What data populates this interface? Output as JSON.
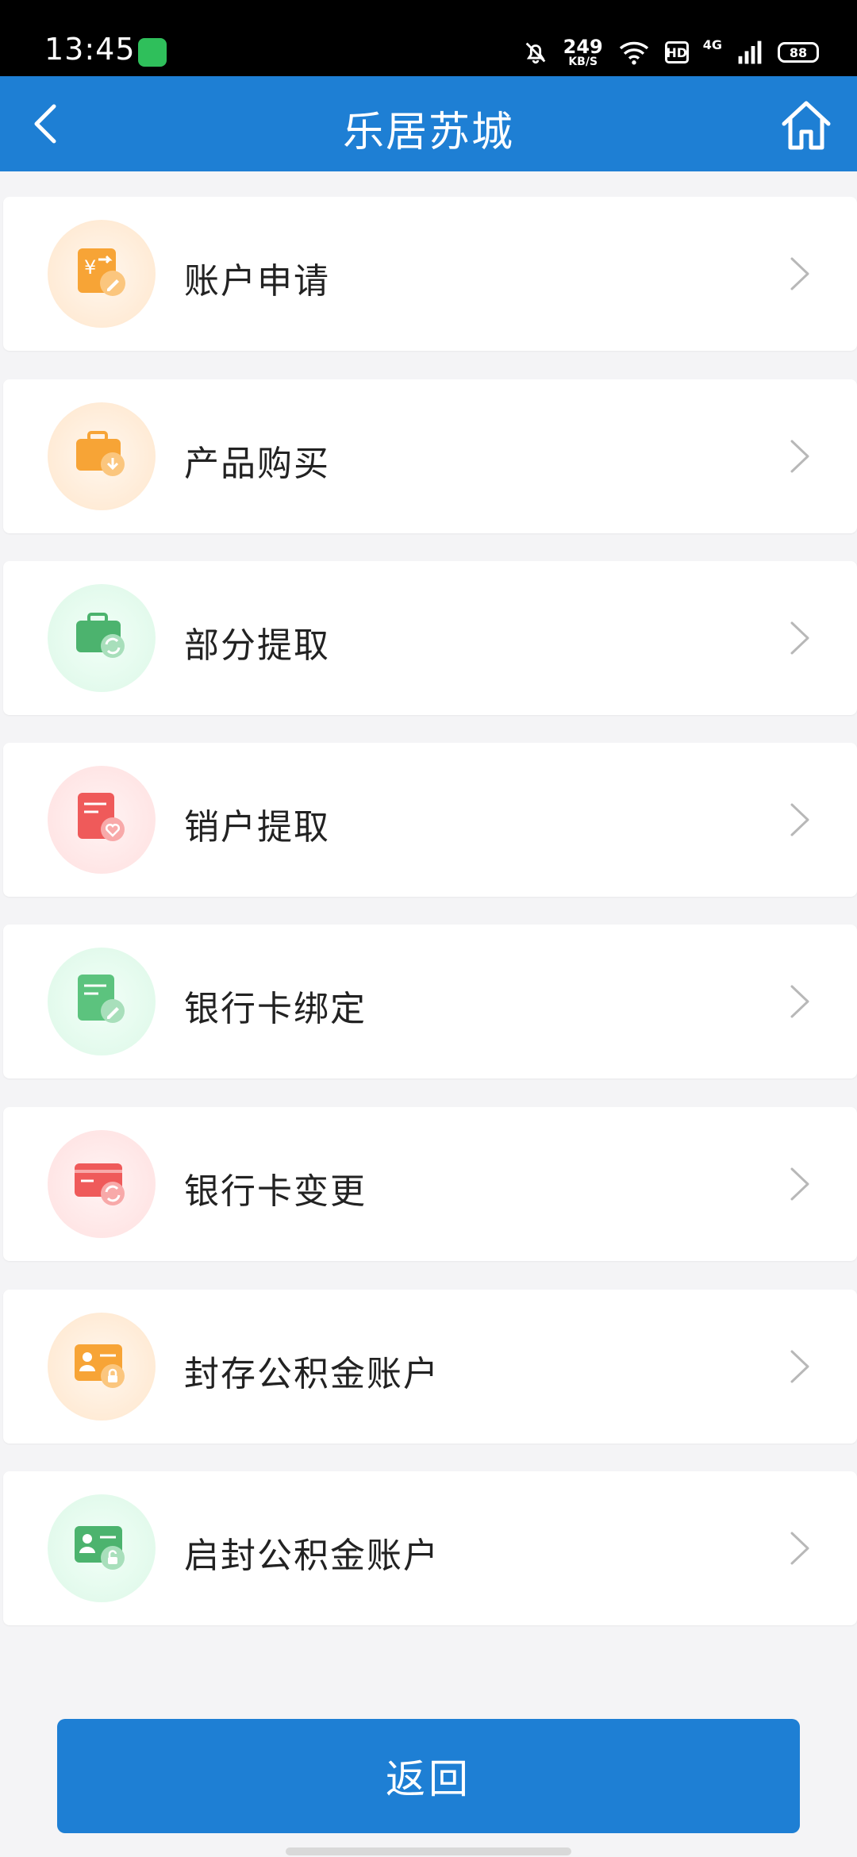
{
  "status_bar": {
    "time": "13:45",
    "speed_value": "249",
    "speed_unit": "KB/S",
    "hd": "HD",
    "network": "4G",
    "battery": "88"
  },
  "header": {
    "title": "乐居苏城"
  },
  "menu": [
    {
      "label": "账户申请",
      "icon": "account-apply-icon",
      "color": "#f7a436"
    },
    {
      "label": "产品购买",
      "icon": "product-purchase-icon",
      "color": "#f7a436"
    },
    {
      "label": "部分提取",
      "icon": "partial-withdraw-icon",
      "color": "#4cb36e"
    },
    {
      "label": "销户提取",
      "icon": "close-account-withdraw-icon",
      "color": "#ef5a5a"
    },
    {
      "label": "银行卡绑定",
      "icon": "bank-card-bind-icon",
      "color": "#5cc37e"
    },
    {
      "label": "银行卡变更",
      "icon": "bank-card-change-icon",
      "color": "#ef5a5a"
    },
    {
      "label": "封存公积金账户",
      "icon": "seal-fund-account-icon",
      "color": "#f7a436"
    },
    {
      "label": "启封公积金账户",
      "icon": "unseal-fund-account-icon",
      "color": "#4cb36e"
    }
  ],
  "footer": {
    "return_label": "返回"
  },
  "colors": {
    "brand": "#1e7fd4",
    "background": "#f4f4f6"
  }
}
